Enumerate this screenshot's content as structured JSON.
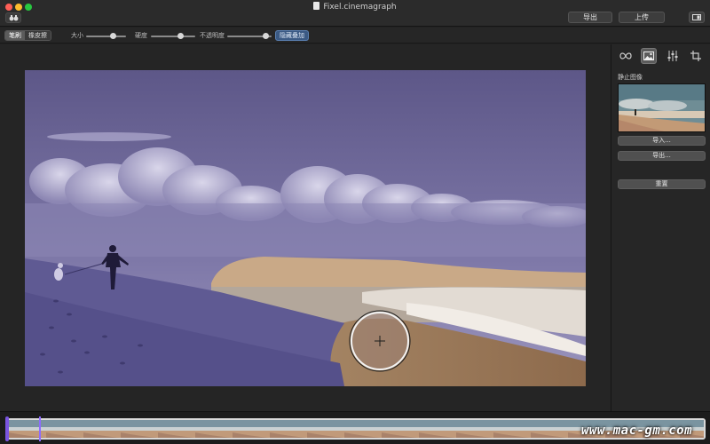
{
  "window": {
    "title": "Fixel.cinemagraph"
  },
  "titlebar": {
    "export_label": "导出",
    "upload_label": "上传"
  },
  "toolbar": {
    "brush_label": "笔刷",
    "eraser_label": "橡皮擦",
    "size_label": "大小",
    "size_value": 0.72,
    "hardness_label": "硬度",
    "hardness_value": 0.7,
    "opacity_label": "不透明度",
    "opacity_value": 0.92,
    "overlay_label": "隐藏叠加"
  },
  "panel": {
    "tabs": [
      {
        "name": "loop-icon"
      },
      {
        "name": "still-image-icon",
        "active": true
      },
      {
        "name": "adjust-icon"
      },
      {
        "name": "crop-icon"
      }
    ],
    "title": "静止图像",
    "import_label": "导入...",
    "export_label": "导出...",
    "reset_label": "重置"
  },
  "timeline": {
    "frame_count": 19
  },
  "watermark": "www.mac-gm.com",
  "colors": {
    "mask_overlay": "#6e6aa8",
    "accent": "#3b5a84",
    "playhead": "#8e6cff"
  }
}
